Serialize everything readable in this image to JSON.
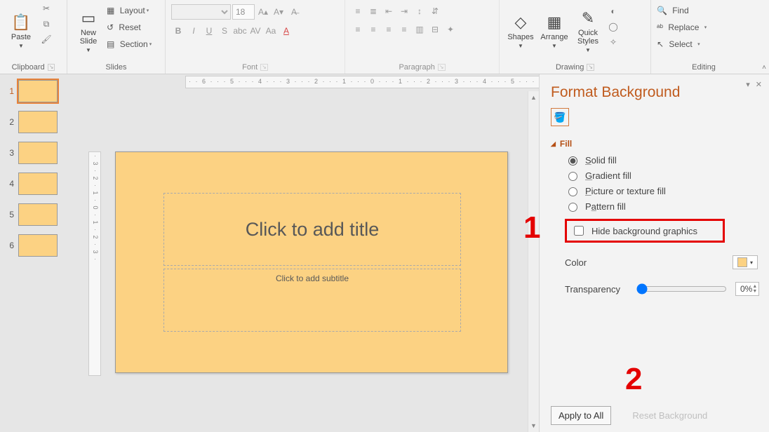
{
  "ribbon": {
    "clipboard": {
      "label": "Clipboard",
      "paste": "Paste"
    },
    "slides": {
      "label": "Slides",
      "newSlide": "New\nSlide",
      "layout": "Layout",
      "reset": "Reset",
      "section": "Section"
    },
    "font": {
      "label": "Font",
      "fontName": "",
      "fontSize": "18"
    },
    "paragraph": {
      "label": "Paragraph"
    },
    "drawing": {
      "label": "Drawing",
      "shapes": "Shapes",
      "arrange": "Arrange",
      "quick": "Quick\nStyles"
    },
    "editing": {
      "label": "Editing",
      "find": "Find",
      "replace": "Replace",
      "select": "Select"
    }
  },
  "ruler": {
    "h": "· · 6 · · · 5 · · · 4 · · · 3 · · · 2 · · · 1 · · · 0 · · · 1 · · · 2 · · · 3 · · · 4 · · · 5 · · · 6 · ·",
    "v": "· 3 · 2 · 1 · 0 · 1 · 2 · 3 ·"
  },
  "thumbs": [
    {
      "n": "1",
      "selected": true
    },
    {
      "n": "2",
      "selected": false
    },
    {
      "n": "3",
      "selected": false
    },
    {
      "n": "4",
      "selected": false
    },
    {
      "n": "5",
      "selected": false
    },
    {
      "n": "6",
      "selected": false
    }
  ],
  "slide": {
    "title": "Click to add title",
    "subtitle": "Click to add subtitle"
  },
  "pane": {
    "title": "Format Background",
    "fill": "Fill",
    "solid": "Solid fill",
    "gradient": "Gradient fill",
    "picture": "Picture or texture fill",
    "pattern": "Pattern fill",
    "hide": "Hide background graphics",
    "color": "Color",
    "transparency": "Transparency",
    "transparencyValue": "0%",
    "apply": "Apply to All",
    "reset": "Reset Background"
  },
  "ann": {
    "one": "1",
    "two": "2"
  }
}
